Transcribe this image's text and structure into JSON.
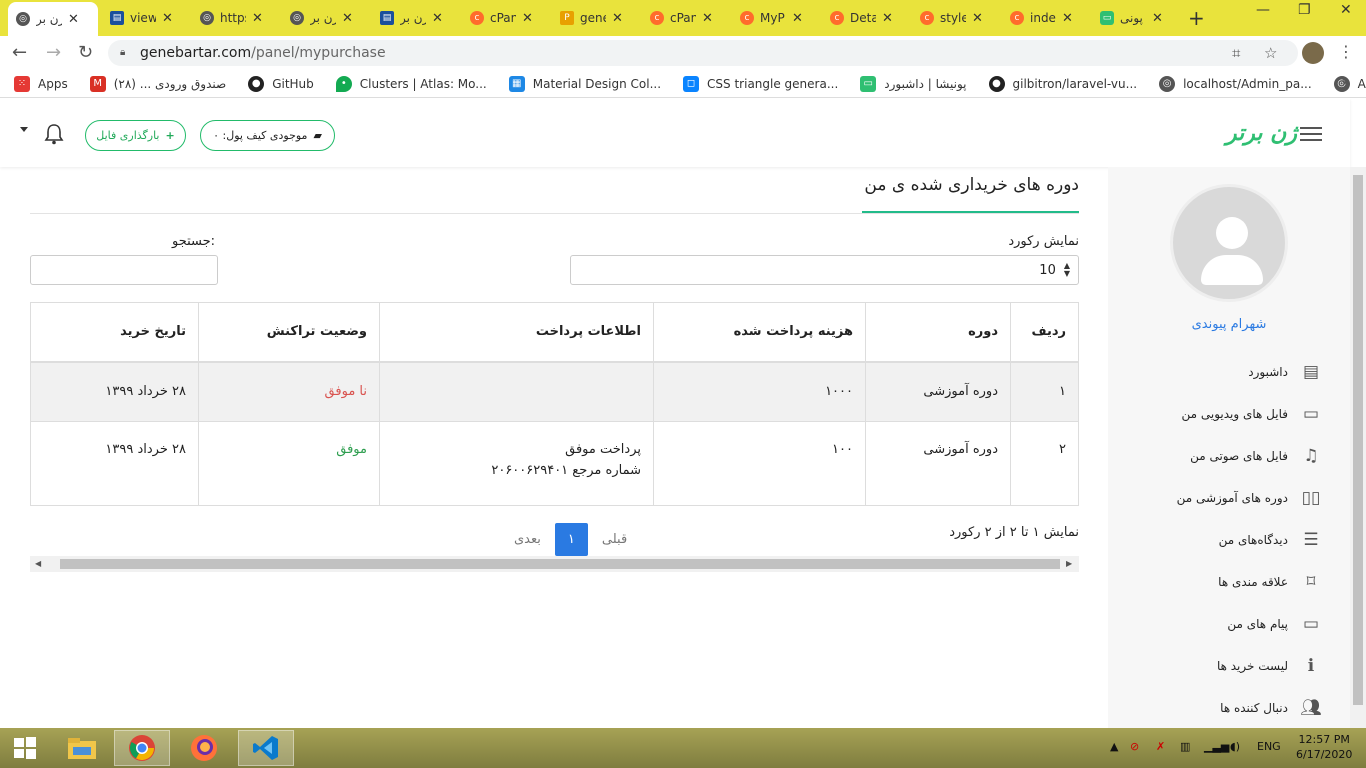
{
  "browser": {
    "tabs": [
      {
        "label": "زن بر",
        "color": "#555555"
      },
      {
        "label": "view",
        "color": "#1a4f9c"
      },
      {
        "label": "https",
        "color": "#555555"
      },
      {
        "label": "زن بر",
        "color": "#555555"
      },
      {
        "label": "زن بر",
        "color": "#1a4f9c"
      },
      {
        "label": "cPan",
        "color": "#ff6c2c"
      },
      {
        "label": "gene",
        "color": "#e8a000"
      },
      {
        "label": "cPan",
        "color": "#ff6c2c"
      },
      {
        "label": "MyP",
        "color": "#ff6c2c"
      },
      {
        "label": "Deta",
        "color": "#ff6c2c"
      },
      {
        "label": "style",
        "color": "#ff6c2c"
      },
      {
        "label": "inde",
        "color": "#ff6c2c"
      },
      {
        "label": "پونی",
        "color": "#2fbf72"
      }
    ],
    "url_host": "genebartar.com",
    "url_path": "/panel/mypurchase",
    "bookmarks": [
      {
        "label": "Apps",
        "color": "#e53935"
      },
      {
        "label": "صندوق ورودی ... (۲۸)",
        "color": "#d93025"
      },
      {
        "label": "GitHub",
        "color": "#222222"
      },
      {
        "label": "Clusters | Atlas: Mo...",
        "color": "#13aa52"
      },
      {
        "label": "Material Design Col...",
        "color": "#1e88e5"
      },
      {
        "label": "CSS triangle genera...",
        "color": "#0a84ff"
      },
      {
        "label": "پونیشا | داشبورد",
        "color": "#2fbf72"
      },
      {
        "label": "gilbitron/laravel-vu...",
        "color": "#222222"
      },
      {
        "label": "localhost/Admin_pa...",
        "color": "#555555"
      },
      {
        "label": "Automation",
        "color": "#555555"
      }
    ]
  },
  "header": {
    "upload_label": "بارگذاری فایل",
    "wallet_label": "موجودی کیف پول: ۰",
    "logo_text": "ژن برتر"
  },
  "sidebar": {
    "username": "شهرام پیوندی",
    "items": [
      {
        "label": "داشبورد",
        "icon": "dashboard-icon"
      },
      {
        "label": "فایل های ویدیویی من",
        "icon": "video-icon"
      },
      {
        "label": "فایل های صوتی من",
        "icon": "music-icon"
      },
      {
        "label": "دوره های آموزشی من",
        "icon": "book-icon"
      },
      {
        "label": "دیدگاه‌های من",
        "icon": "comment-icon"
      },
      {
        "label": "علاقه مندی ها",
        "icon": "bookmark-icon"
      },
      {
        "label": "پیام های من",
        "icon": "laptop-icon"
      },
      {
        "label": "لیست خرید ها",
        "icon": "info-icon"
      },
      {
        "label": "دنبال کننده ها",
        "icon": "users-icon"
      }
    ]
  },
  "main": {
    "title": "دوره های خریداری شده ی من",
    "records_label": "نمایش رکورد",
    "records_value": "10",
    "search_label": "جستجو:",
    "columns": [
      "ردیف",
      "دوره",
      "هزینه پرداخت شده",
      "اطلاعات پرداخت",
      "وضعیت تراکنش",
      "تاریخ خرید"
    ],
    "rows": [
      {
        "index": "۱",
        "course": "دوره آموزشی",
        "cost": "۱۰۰۰",
        "payment_line1": "",
        "payment_line2": "",
        "status": "نا موفق",
        "date": "۲۸ خرداد ۱۳۹۹"
      },
      {
        "index": "۲",
        "course": "دوره آموزشی",
        "cost": "۱۰۰",
        "payment_line1": "پرداخت موفق",
        "payment_line2": "شماره مرجع ۲۰۶۰۰۶۲۹۴۰۱",
        "status": "موفق",
        "date": "۲۸ خرداد ۱۳۹۹"
      }
    ],
    "info": "نمایش ۱ تا ۲ از ۲ رکورد",
    "prev_label": "قبلی",
    "next_label": "بعدی",
    "current_page": "۱"
  },
  "taskbar": {
    "lang": "ENG",
    "time": "12:57 PM",
    "date": "6/17/2020"
  },
  "colors": {
    "tabbar": "#e9e33c",
    "accent_green": "#22bb6a",
    "link_blue": "#2a7ae2",
    "fail_red": "#d9534f",
    "ok_green": "#2e9e4f"
  }
}
